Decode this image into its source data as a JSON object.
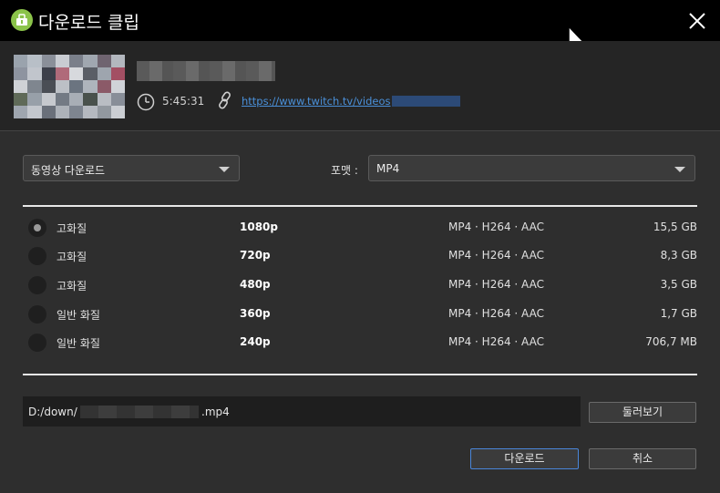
{
  "window": {
    "title": "다운로드 클립"
  },
  "clip": {
    "duration": "5:45:31",
    "url": "https://www.twitch.tv/videos"
  },
  "options": {
    "mode_value": "동영상 다운로드",
    "format_label": "포맷 :",
    "format_value": "MP4"
  },
  "qualities": [
    {
      "label": "고화질",
      "resolution": "1080p",
      "codec": "MP4 · H264 · AAC",
      "size": "15,5 GB",
      "selected": true
    },
    {
      "label": "고화질",
      "resolution": "720p",
      "codec": "MP4 · H264 · AAC",
      "size": "8,3 GB",
      "selected": false
    },
    {
      "label": "고화질",
      "resolution": "480p",
      "codec": "MP4 · H264 · AAC",
      "size": "3,5 GB",
      "selected": false
    },
    {
      "label": "일반 화질",
      "resolution": "360p",
      "codec": "MP4 · H264 · AAC",
      "size": "1,7 GB",
      "selected": false
    },
    {
      "label": "일반 화질",
      "resolution": "240p",
      "codec": "MP4 · H264 · AAC",
      "size": "706,7 MB",
      "selected": false
    }
  ],
  "output": {
    "path_prefix": "D:/down/",
    "path_suffix": ".mp4",
    "browse_label": "둘러보기"
  },
  "actions": {
    "download_label": "다운로드",
    "cancel_label": "취소"
  },
  "colors": {
    "accent": "#8bc34a",
    "link": "#4a90d9",
    "primary_border": "#4a86d9"
  }
}
